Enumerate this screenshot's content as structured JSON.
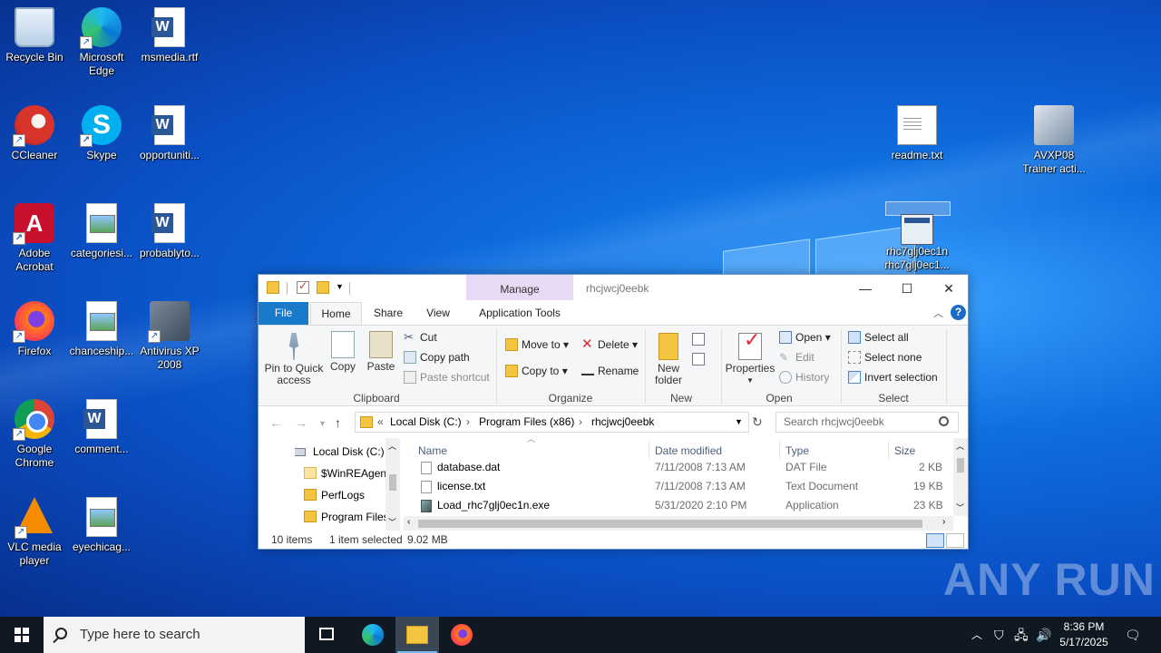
{
  "desktop": {
    "icons": [
      {
        "label": "Recycle Bin"
      },
      {
        "label": "Microsoft Edge"
      },
      {
        "label": "msmedia.rtf"
      },
      {
        "label": "CCleaner"
      },
      {
        "label": "Skype"
      },
      {
        "label": "opportuniti..."
      },
      {
        "label": "Adobe Acrobat"
      },
      {
        "label": "categoriesi..."
      },
      {
        "label": "probablyto..."
      },
      {
        "label": "Firefox"
      },
      {
        "label": "chanceship..."
      },
      {
        "label": "Antivirus XP 2008"
      },
      {
        "label": "Google Chrome"
      },
      {
        "label": "comment..."
      },
      {
        "label": "VLC media player"
      },
      {
        "label": "eyechicag..."
      },
      {
        "label": "readme.txt"
      },
      {
        "label": "AVXP08 Trainer acti..."
      }
    ],
    "dragging": {
      "line1": "rhc7glj0ec1n",
      "line2": "rhc7glj0ec1..."
    },
    "watermark": "ANY RUN"
  },
  "explorer": {
    "title": "rhcjwcj0eebk",
    "manage_tab": "Manage",
    "tabs": {
      "file": "File",
      "home": "Home",
      "share": "Share",
      "view": "View",
      "app_tools": "Application Tools"
    },
    "ribbon": {
      "clipboard": {
        "label": "Clipboard",
        "pin": "Pin to Quick access",
        "copy": "Copy",
        "paste": "Paste",
        "cut": "Cut",
        "copy_path": "Copy path",
        "paste_shortcut": "Paste shortcut"
      },
      "organize": {
        "label": "Organize",
        "move_to": "Move to",
        "copy_to": "Copy to",
        "delete": "Delete",
        "rename": "Rename"
      },
      "new": {
        "label": "New",
        "new_folder": "New folder"
      },
      "open": {
        "label": "Open",
        "properties": "Properties",
        "open": "Open",
        "edit": "Edit",
        "history": "History"
      },
      "select": {
        "label": "Select",
        "select_all": "Select all",
        "select_none": "Select none",
        "invert": "Invert selection"
      }
    },
    "address": {
      "prefix": "«",
      "segments": [
        "Local Disk (C:)",
        "Program Files (x86)",
        "rhcjwcj0eebk"
      ]
    },
    "search_placeholder": "Search rhcjwcj0eebk",
    "nav": [
      {
        "label": "Local Disk (C:)"
      },
      {
        "label": "$WinREAgent"
      },
      {
        "label": "PerfLogs"
      },
      {
        "label": "Program Files"
      }
    ],
    "columns": {
      "name": "Name",
      "date": "Date modified",
      "type": "Type",
      "size": "Size"
    },
    "files": [
      {
        "name": "database.dat",
        "date": "7/11/2008 7:13 AM",
        "type": "DAT File",
        "size": "2 KB"
      },
      {
        "name": "license.txt",
        "date": "7/11/2008 7:13 AM",
        "type": "Text Document",
        "size": "19 KB"
      },
      {
        "name": "Load_rhc7glj0ec1n.exe",
        "date": "5/31/2020 2:10 PM",
        "type": "Application",
        "size": "23 KB"
      }
    ],
    "status": {
      "items": "10 items",
      "selected": "1 item selected",
      "size": "9.02 MB"
    }
  },
  "taskbar": {
    "search_placeholder": "Type here to search",
    "time": "8:36 PM",
    "date": "5/17/2025"
  }
}
